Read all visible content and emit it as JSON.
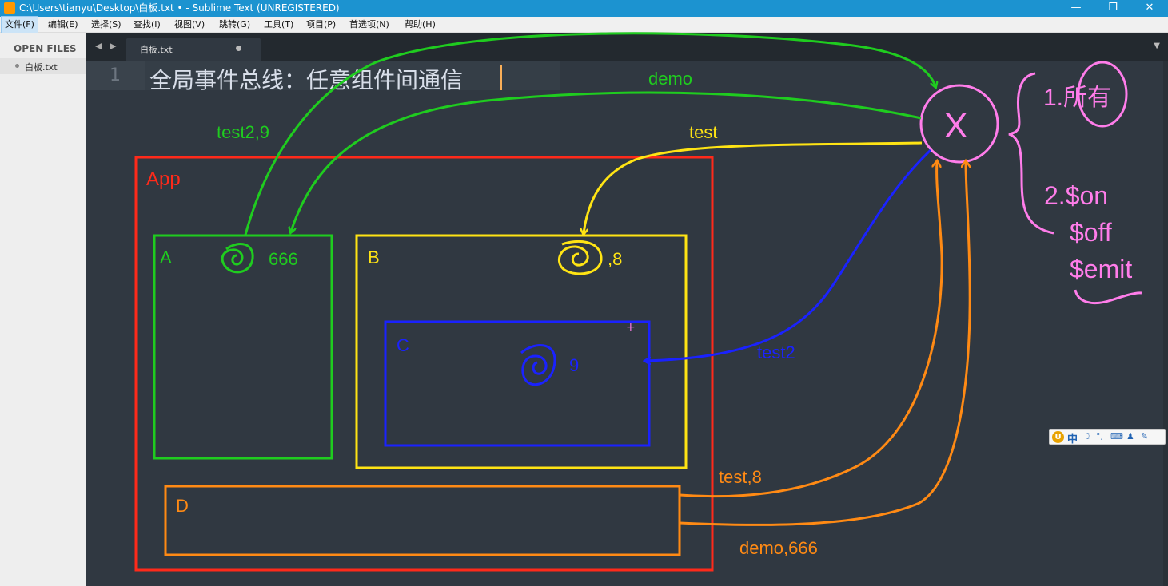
{
  "window": {
    "title": "C:\\Users\\tianyu\\Desktop\\白板.txt • - Sublime Text (UNREGISTERED)",
    "minimize": "—",
    "restore": "❐",
    "close": "✕"
  },
  "menu": {
    "items": [
      {
        "label": "文件(F)"
      },
      {
        "label": "编辑(E)"
      },
      {
        "label": "选择(S)"
      },
      {
        "label": "查找(I)"
      },
      {
        "label": "视图(V)"
      },
      {
        "label": "跳转(G)"
      },
      {
        "label": "工具(T)"
      },
      {
        "label": "项目(P)"
      },
      {
        "label": "首选项(N)"
      },
      {
        "label": "帮助(H)"
      }
    ]
  },
  "sidebar": {
    "header": "OPEN FILES",
    "files": [
      {
        "name": "白板.txt"
      }
    ]
  },
  "tabs": {
    "nav": "◀ ▶",
    "items": [
      {
        "label": "白板.txt",
        "dirty": true
      }
    ],
    "dropdown": "▼"
  },
  "editor": {
    "line_number": "1",
    "line_text": "全局事件总线：任意组件间通信"
  },
  "annotations": {
    "app_label": "App",
    "a_label": "A",
    "a_value": "666",
    "b_label": "B",
    "b_value": ",8",
    "c_label": "C",
    "c_value": "9",
    "d_label": "D",
    "bus_symbol": "X",
    "edge_demo": "demo",
    "edge_test2_9": "test2,9",
    "edge_test": "test",
    "edge_test2": "test2",
    "edge_test_8": "test,8",
    "edge_demo_666": "demo,666",
    "note_1": "1.所有",
    "note_2": "2.$on",
    "note_off": "$off",
    "note_emit": "$emit"
  },
  "colors": {
    "app": "#ff2a1a",
    "a": "#1fcc1f",
    "b": "#ffe414",
    "c": "#1a22ff",
    "d": "#ff8a14",
    "bus": "#ff7dea"
  },
  "ime": {
    "logo": "U",
    "mode": "中",
    "moon": "☽",
    "punct": "°,",
    "keyboard": "⌨",
    "user": "♟",
    "tool": "✎"
  }
}
